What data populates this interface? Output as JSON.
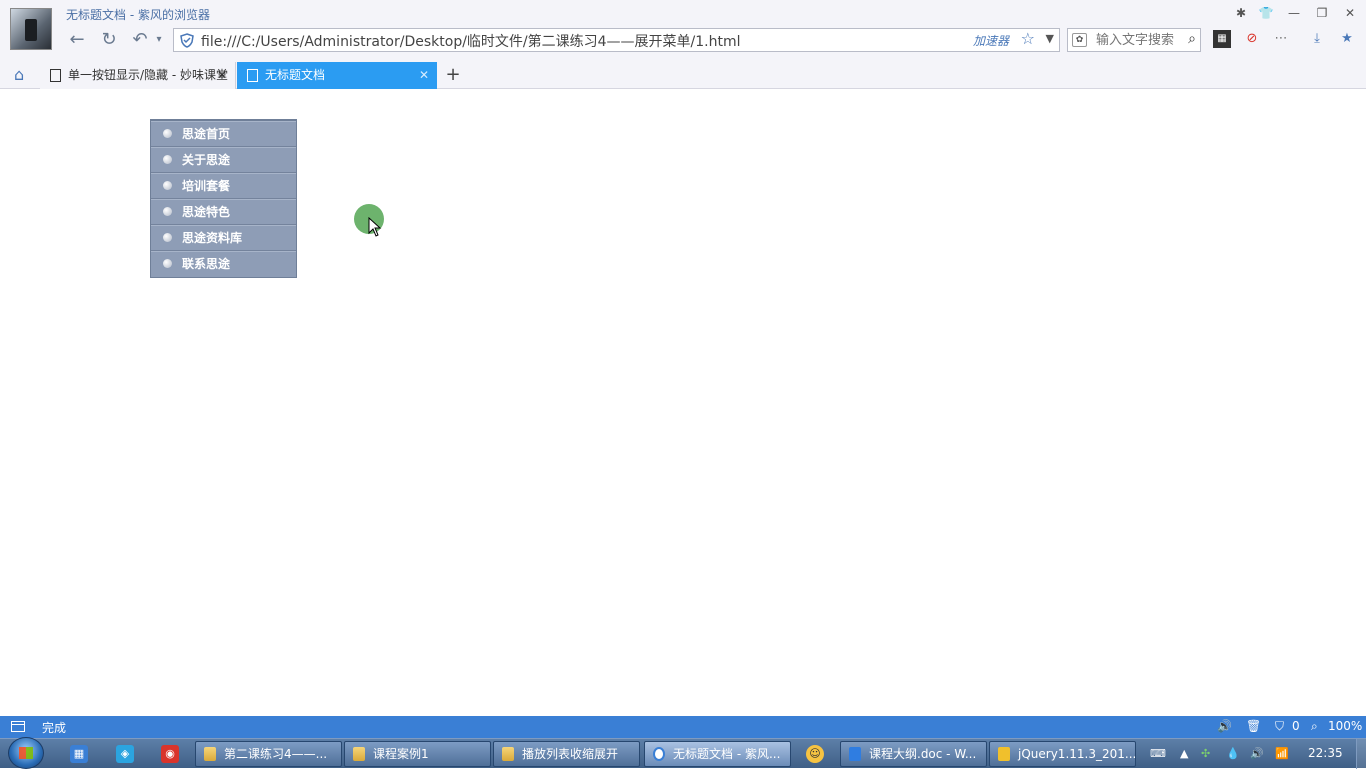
{
  "window": {
    "title": "无标题文档 - 紫风的浏览器"
  },
  "address_bar": {
    "url": "file:///C:/Users/Administrator/Desktop/临时文件/第二课练习4——展开菜单/1.html",
    "accelerator_label": "加速器"
  },
  "search": {
    "placeholder": "输入文字搜索"
  },
  "tabs": [
    {
      "label": "单一按钮显示/隐藏 - 妙味课堂",
      "active": false
    },
    {
      "label": "无标题文档",
      "active": true
    }
  ],
  "menu": {
    "items": [
      "思途首页",
      "关于思途",
      "培训套餐",
      "思途特色",
      "思途资料库",
      "联系思途"
    ]
  },
  "status_bar": {
    "text": "完成",
    "shield_count": "0",
    "zoom": "100%"
  },
  "taskbar": {
    "items": [
      {
        "label": "第二课练习4——...",
        "icon": "folder-icon"
      },
      {
        "label": "课程案例1",
        "icon": "folder-icon"
      },
      {
        "label": "播放列表收缩展开",
        "icon": "folder-icon"
      },
      {
        "label": "无标题文档 - 紫风...",
        "icon": "browser-icon"
      },
      {
        "label": "课程大纲.doc - W...",
        "icon": "word-icon"
      },
      {
        "label": "jQuery1.11.3_201...",
        "icon": "help-icon"
      }
    ],
    "clock": "22:35"
  },
  "colors": {
    "menu_bg": "#8e9db6",
    "active_tab": "#2b9cf2",
    "status_bar": "#3a7fd5",
    "cursor_highlight": "#6db36d"
  }
}
